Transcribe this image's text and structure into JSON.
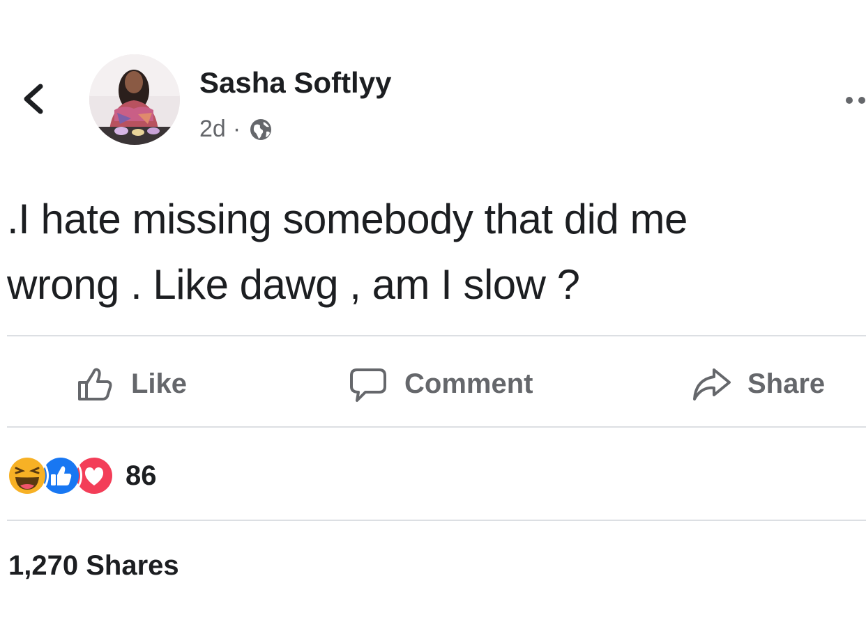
{
  "post": {
    "author": "Sasha Softlyy",
    "time": "2d",
    "separator": "·",
    "text": ".I hate missing somebody that did me\nwrong . Like dawg , am I slow ?"
  },
  "icons": {
    "back": "back-chevron-icon",
    "privacy": "globe-icon",
    "more": "more-dots-icon"
  },
  "actions": {
    "like": "Like",
    "comment": "Comment",
    "share": "Share"
  },
  "reactions": {
    "types": [
      "haha",
      "like",
      "love"
    ],
    "count": "86"
  },
  "shares": "1,270 Shares",
  "colors": {
    "text": "#1c1e21",
    "muted": "#65676b",
    "divider": "#dcdfe3",
    "like_blue": "#1877f2",
    "love_red": "#f33e58",
    "haha_yellow": "#f7b125"
  }
}
